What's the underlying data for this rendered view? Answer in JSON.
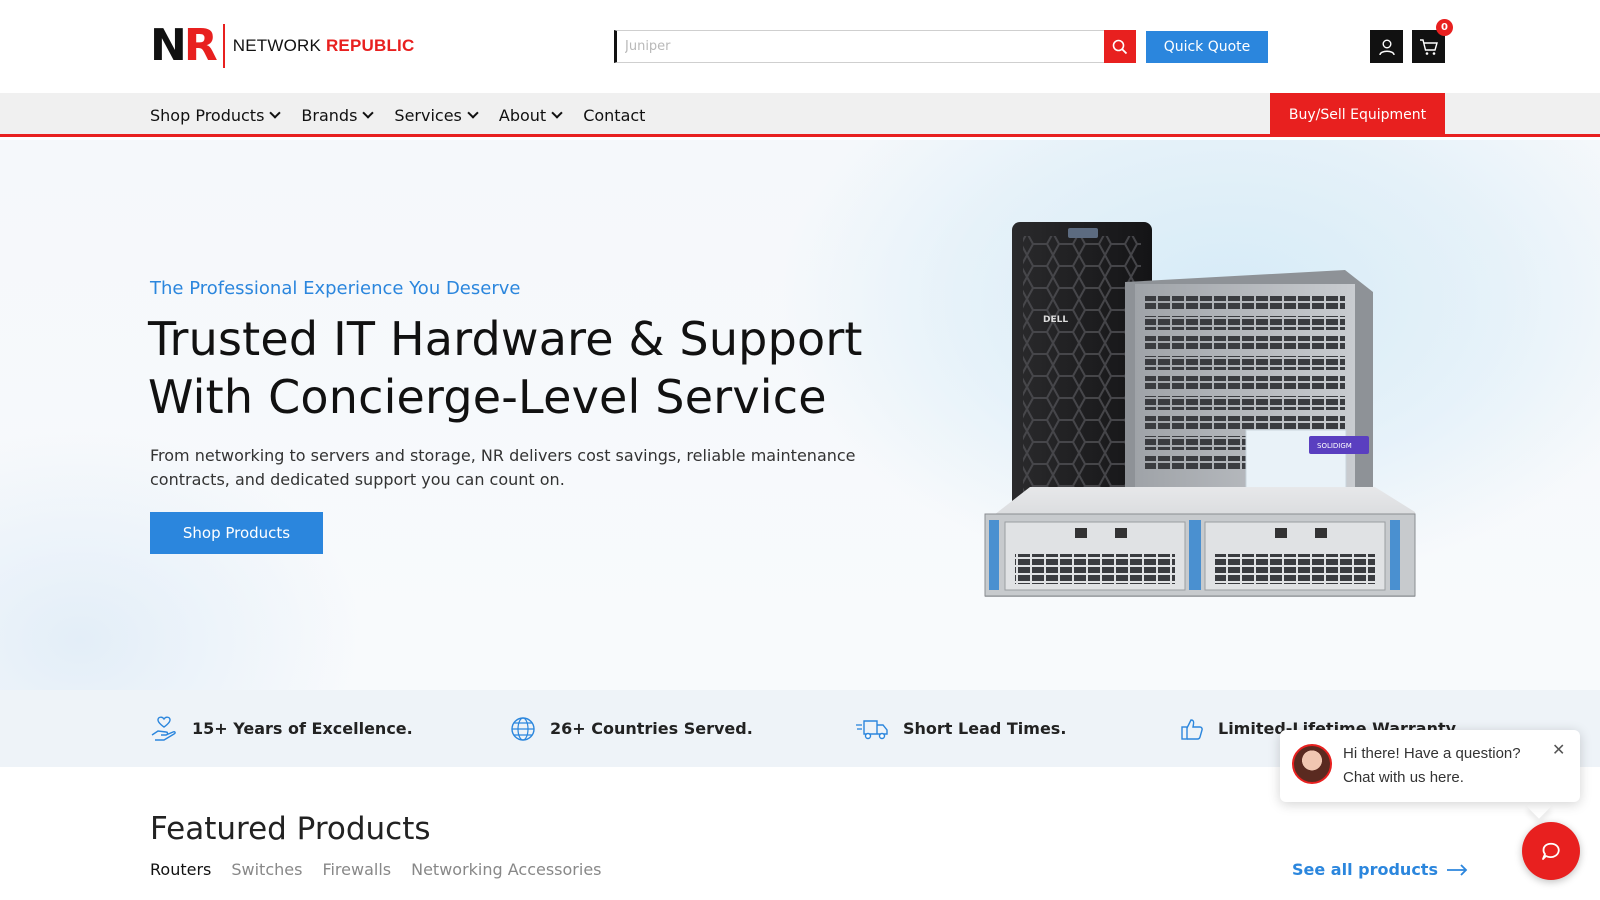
{
  "brand": {
    "mark_n": "N",
    "mark_r": "R",
    "name_part1": "NETWORK",
    "name_part2": "REPUBLIC",
    "accent_color": "#e8201f",
    "blue_color": "#2b86dd"
  },
  "header": {
    "search_placeholder": "Juniper",
    "search_icon": "search-icon",
    "quick_quote_label": "Quick Quote",
    "user_icon": "user-icon",
    "cart_icon": "cart-icon",
    "cart_count": "0"
  },
  "nav": {
    "items": [
      {
        "label": "Shop Products",
        "has_dropdown": true
      },
      {
        "label": "Brands",
        "has_dropdown": true
      },
      {
        "label": "Services",
        "has_dropdown": true
      },
      {
        "label": "About",
        "has_dropdown": true
      },
      {
        "label": "Contact",
        "has_dropdown": false
      }
    ],
    "cta_label": "Buy/Sell Equipment"
  },
  "hero": {
    "tagline": "The Professional Experience You Deserve",
    "title_line1": "Trusted IT Hardware & Support",
    "title_line2": "With Concierge-Level Service",
    "description": "From networking to servers and storage, NR delivers cost savings, reliable maintenance contracts, and dedicated support you can count on.",
    "button_label": "Shop Products",
    "image_badge_text": "SOLIDIGM",
    "server_brand": "DELL"
  },
  "features": [
    {
      "icon": "hand-heart-icon",
      "text": "15+ Years of Excellence."
    },
    {
      "icon": "globe-icon",
      "text": "26+ Countries Served."
    },
    {
      "icon": "truck-icon",
      "text": "Short Lead Times."
    },
    {
      "icon": "thumbs-up-icon",
      "text": "Limited-Lifetime Warranty"
    }
  ],
  "featured": {
    "title": "Featured Products",
    "tabs": [
      "Routers",
      "Switches",
      "Firewalls",
      "Networking Accessories"
    ],
    "active_tab": "Routers",
    "see_all_label": "See all products"
  },
  "chat": {
    "line1": "Hi there! Have a question?",
    "line2": "Chat with us here.",
    "close_icon": "close-icon",
    "fab_icon": "chat-bubble-icon"
  }
}
